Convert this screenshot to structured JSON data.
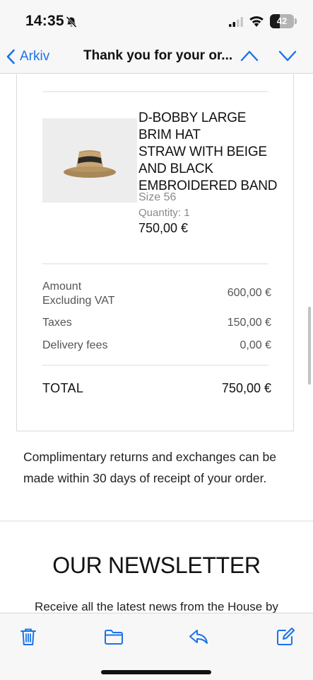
{
  "status_bar": {
    "time": "14:35",
    "battery_level": "42",
    "battery_fraction": 0.42,
    "icons": [
      "bell-slash-icon",
      "cellular-signal-icon",
      "wifi-icon",
      "battery-icon"
    ]
  },
  "nav": {
    "back_label": "Arkiv",
    "title": "Thank you for your or...",
    "icons": [
      "chevron-left-icon",
      "chevron-up-icon",
      "chevron-down-icon"
    ]
  },
  "product": {
    "name_lines": [
      "D-BOBBY LARGE",
      "BRIM HAT",
      "STRAW WITH BEIGE",
      "AND BLACK",
      "EMBROIDERED BAND"
    ],
    "size": "Size 56",
    "quantity": "Quantity: 1",
    "price": "750,00 €"
  },
  "summary": {
    "amount_label_line1": "Amount",
    "amount_label_line2": "Excluding VAT",
    "amount_value": "600,00 €",
    "taxes_label": "Taxes",
    "taxes_value": "150,00 €",
    "delivery_label": "Delivery fees",
    "delivery_value": "0,00 €",
    "total_label": "TOTAL",
    "total_value": "750,00 €"
  },
  "returns_text": "Complimentary returns and exchanges can be made within 30 days of receipt of your order.",
  "newsletter": {
    "title": "OUR NEWSLETTER",
    "text": "Receive all the latest news from the House by"
  },
  "toolbar": {
    "icons": [
      "trash-icon",
      "folder-icon",
      "reply-icon",
      "compose-icon"
    ]
  },
  "colors": {
    "accent": "#1a73e8",
    "bar_background": "#f7f7f8",
    "muted_text": "#8a8a8a",
    "product_image_bg": "#ededed"
  }
}
